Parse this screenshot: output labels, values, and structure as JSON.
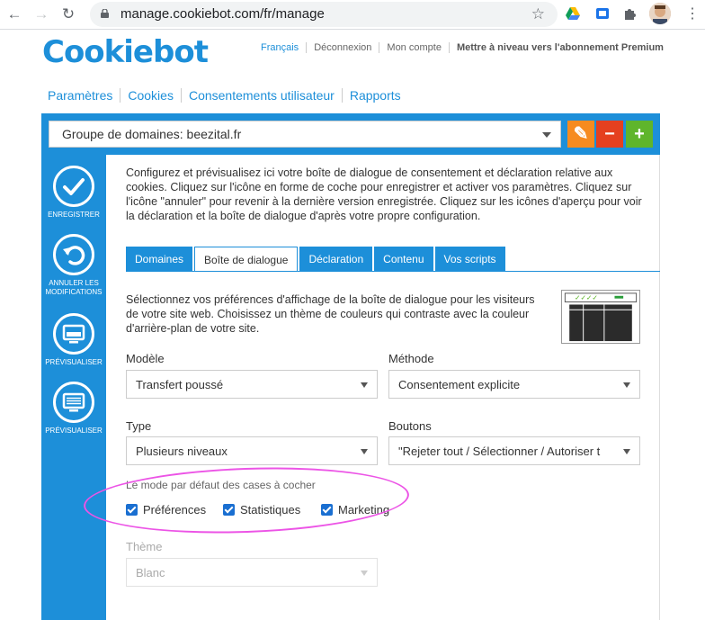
{
  "browser": {
    "url": "manage.cookiebot.com/fr/manage"
  },
  "header": {
    "logo_text": "Cookiebot",
    "links": [
      "Français",
      "Déconnexion",
      "Mon compte",
      "Mettre à niveau vers l'abonnement Premium"
    ]
  },
  "nav": {
    "items": [
      "Paramètres",
      "Cookies",
      "Consentements utilisateur",
      "Rapports"
    ]
  },
  "domain_group": {
    "value": "Groupe de domaines: beezital.fr"
  },
  "toolbar": {
    "edit": "✎",
    "remove": "−",
    "add": "+"
  },
  "sidebar": {
    "save": "ENREGISTRER",
    "undo": "ANNULER LES MODIFICATIONS",
    "preview1": "PRÉVISUALISER",
    "preview2": "PRÉVISUALISER"
  },
  "intro_text": "Configurez et prévisualisez ici votre boîte de dialogue de consentement et déclaration relative aux cookies. Cliquez sur l'icône en forme de coche pour enregistrer et activer vos paramètres. Cliquez sur l'icône \"annuler\" pour revenir à la dernière version enregistrée. Cliquez sur les icônes d'aperçu pour voir la déclaration et la boîte de dialogue d'après votre propre configuration.",
  "tabs": [
    "Domaines",
    "Boîte de dialogue",
    "Déclaration",
    "Contenu",
    "Vos scripts"
  ],
  "dialog_desc": "Sélectionnez vos préférences d'affichage de la boîte de dialogue pour les visiteurs de votre site web. Choisissez un thème de couleurs qui contraste avec la couleur d'arrière-plan de votre site.",
  "fields": {
    "modele_label": "Modèle",
    "modele_value": "Transfert poussé",
    "methode_label": "Méthode",
    "methode_value": "Consentement explicite",
    "type_label": "Type",
    "type_value": "Plusieurs niveaux",
    "boutons_label": "Boutons",
    "boutons_value": "\"Rejeter tout / Sélectionner / Autoriser t",
    "theme_label": "Thème",
    "theme_value": "Blanc"
  },
  "checkbox_group": {
    "label": "Le mode par défaut des cases à cocher",
    "items": [
      "Préférences",
      "Statistiques",
      "Marketing"
    ]
  },
  "colors": {
    "brand": "#1d8fd9",
    "edit": "#f68b1f",
    "remove": "#e5401f",
    "add": "#5fb52b",
    "highlight": "#ec54e6"
  }
}
